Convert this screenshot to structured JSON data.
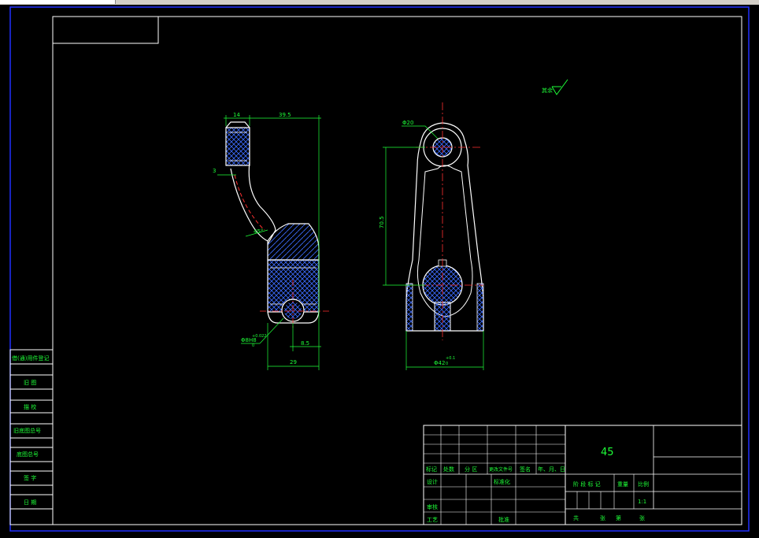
{
  "window": {
    "tab_label": ""
  },
  "colors": {
    "background": "#000000",
    "frame": "#ffffff",
    "dimension": "#1eff38",
    "center_line": "#ff2020",
    "hatch": "#4a6bff",
    "border": "#1a1aff"
  },
  "roughness": {
    "symbol": "√",
    "label": "其余"
  },
  "side_view_dims": {
    "d14": "14",
    "d395": "39.5",
    "d3": "3",
    "d45": "45°",
    "d85": "8.5",
    "d29": "29",
    "hole": "Φ8H8",
    "hole_tol_up": "+0.022",
    "hole_tol_dn": "0"
  },
  "front_view_dims": {
    "d20": "Φ20",
    "d705": "70.5",
    "d42": "Φ42",
    "d42_tol_up": "+0.1",
    "d42_tol_dn": "0"
  },
  "title_block": {
    "material": "45",
    "h_biaoji": "标记",
    "h_chushu": "处数",
    "h_fenqu": "分 区",
    "h_gengai": "更改文件号",
    "h_qianming": "签名",
    "h_date": "年、月、日",
    "h_sheji": "设计",
    "h_biaozhunhua": "标准化",
    "h_shenhe": "审核",
    "h_gongyi": "工艺",
    "h_pizhun": "批准",
    "h_jieduan": "阶 段 标 记",
    "h_zhongliang": "重量",
    "h_bili": "比例",
    "scale": "1:1",
    "h_gong": "共",
    "h_zhang": "张",
    "h_di": "第",
    "h_zhang2": "张"
  },
  "left_strip": {
    "items": [
      "借(通)用件登记",
      "旧 图",
      "描 校",
      "旧底图总号",
      "底图总号",
      "签 字",
      "日 期"
    ]
  }
}
